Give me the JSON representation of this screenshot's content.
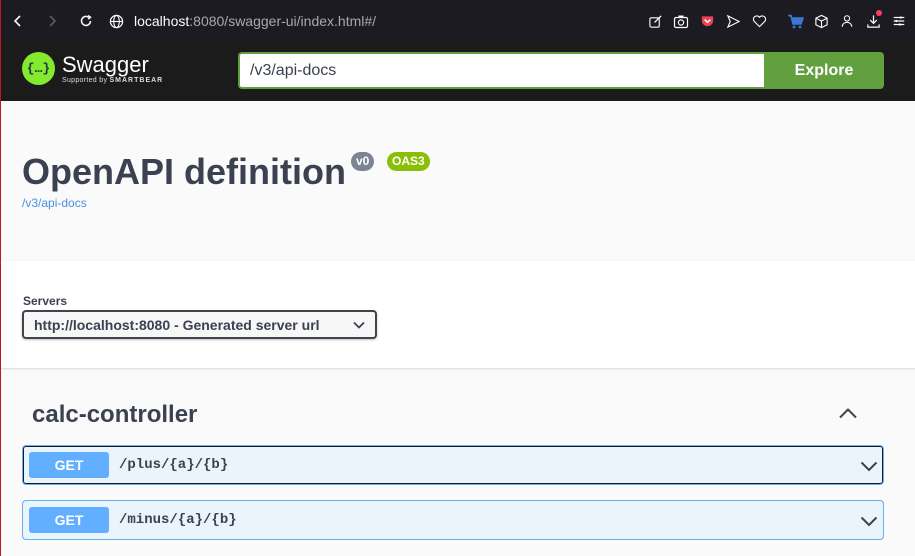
{
  "browser": {
    "url_host": "localhost",
    "url_rest": ":8080/swagger-ui/index.html#/"
  },
  "header": {
    "logo_title": "Swagger",
    "logo_supported": "Supported by",
    "logo_brand": "SMARTBEAR",
    "url_value": "/v3/api-docs",
    "explore_label": "Explore"
  },
  "info": {
    "title": "OpenAPI definition",
    "version_badge": "v0",
    "oas_badge": "OAS3",
    "spec_link": "/v3/api-docs"
  },
  "servers": {
    "label": "Servers",
    "selected": "http://localhost:8080 - Generated server url"
  },
  "tag": {
    "name": "calc-controller"
  },
  "operations": [
    {
      "method": "GET",
      "path": "/plus/{a}/{b}"
    },
    {
      "method": "GET",
      "path": "/minus/{a}/{b}"
    }
  ],
  "colors": {
    "get_method": "#61affe",
    "explore": "#62a03f",
    "oas_badge": "#89bf04",
    "version_badge": "#7d8492"
  }
}
